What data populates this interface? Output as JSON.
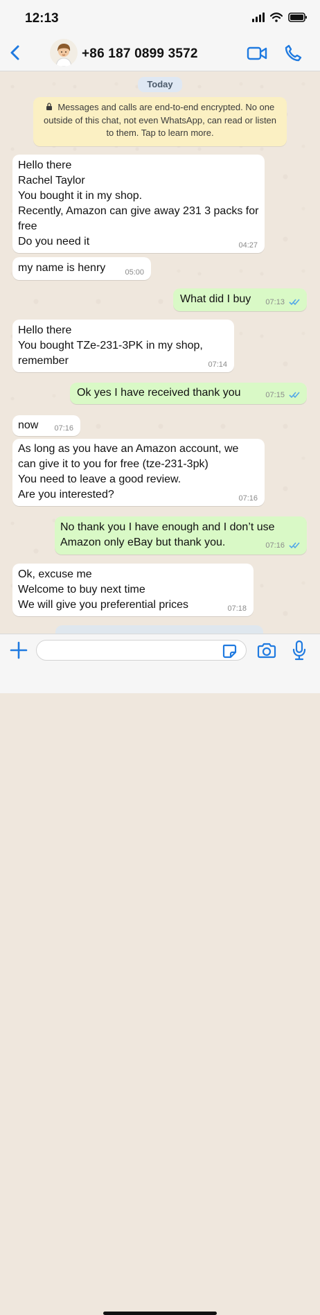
{
  "status_bar": {
    "time": "12:13",
    "signal_icon": "signal-bars-icon",
    "wifi_icon": "wifi-icon",
    "battery_icon": "battery-icon"
  },
  "header": {
    "back_icon": "chevron-left-icon",
    "avatar_icon": "avatar",
    "contact_name": "+86 187 0899 3572",
    "video_call_icon": "video-camera-icon",
    "voice_call_icon": "phone-icon"
  },
  "chat": {
    "date_label": "Today",
    "encryption_notice": "Messages and calls are end-to-end encrypted. No one outside of this chat, not even WhatsApp, can read or listen to them. Tap to learn more.",
    "messages": [
      {
        "direction": "incoming",
        "text": "Hello there\nRachel Taylor\nYou bought it in my shop.\nRecently, Amazon can give away 231 3 packs for free\nDo you need it",
        "time": "04:27"
      },
      {
        "direction": "incoming",
        "text": "my name is henry",
        "time": "05:00"
      },
      {
        "direction": "outgoing",
        "text": "What did I buy",
        "time": "07:13",
        "status": "read"
      },
      {
        "direction": "incoming",
        "text": "Hello there\nYou bought TZe-231-3PK in my shop,\nremember",
        "time": "07:14"
      },
      {
        "direction": "outgoing",
        "text": "Ok yes I have received thank you",
        "time": "07:15",
        "status": "read"
      },
      {
        "direction": "incoming",
        "text": "now",
        "time": "07:16"
      },
      {
        "direction": "incoming",
        "text": "As long as you have an Amazon account, we can give it to you for free (tze-231-3pk)\nYou need to leave a good review.\nAre you interested?",
        "time": "07:16"
      },
      {
        "direction": "outgoing",
        "text": "No thank you I have enough and I don’t use Amazon only eBay but thank you.",
        "time": "07:16",
        "status": "read"
      },
      {
        "direction": "incoming",
        "text": "Ok, excuse me\nWelcome to buy next time\nWe will give you preferential prices",
        "time": "07:18"
      }
    ]
  },
  "composer": {
    "add_icon": "plus-icon",
    "message_value": "",
    "message_placeholder": "",
    "sticker_icon": "sticker-icon",
    "camera_icon": "camera-icon",
    "mic_icon": "microphone-icon"
  },
  "colors": {
    "accent": "#1f7ae0",
    "incoming_bubble": "#ffffff",
    "outgoing_bubble": "#d9f9c6",
    "encryption_bubble": "#fbf0c3",
    "chat_background": "#efe7dd",
    "read_tick": "#53a7e8"
  }
}
